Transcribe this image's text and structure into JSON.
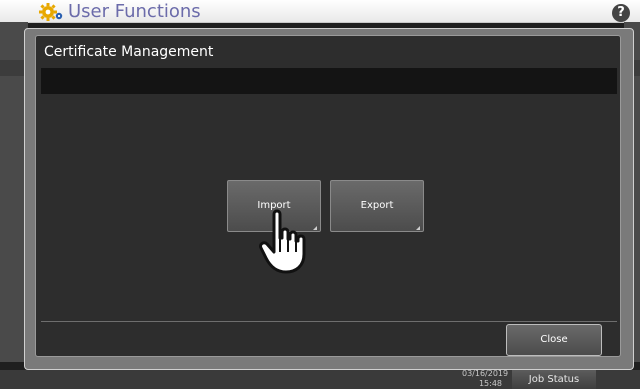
{
  "header": {
    "title": "User Functions",
    "icon": "gear-icon",
    "help_icon": "help-icon",
    "help_label": "?"
  },
  "dialog": {
    "title": "Certificate Management",
    "message": "",
    "buttons": {
      "import_label": "Import",
      "export_label": "Export"
    },
    "close_label": "Close"
  },
  "status_bar": {
    "date": "03/16/2019",
    "time": "15:48",
    "job_status_label": "Job Status"
  },
  "colors": {
    "title_text": "#6b6baa",
    "gear_yellow": "#e8a800",
    "panel_bg": "#2d2d2d",
    "button_bg": "#5a5a5a"
  },
  "overlay": {
    "cursor_icon": "hand-pointer-icon"
  }
}
